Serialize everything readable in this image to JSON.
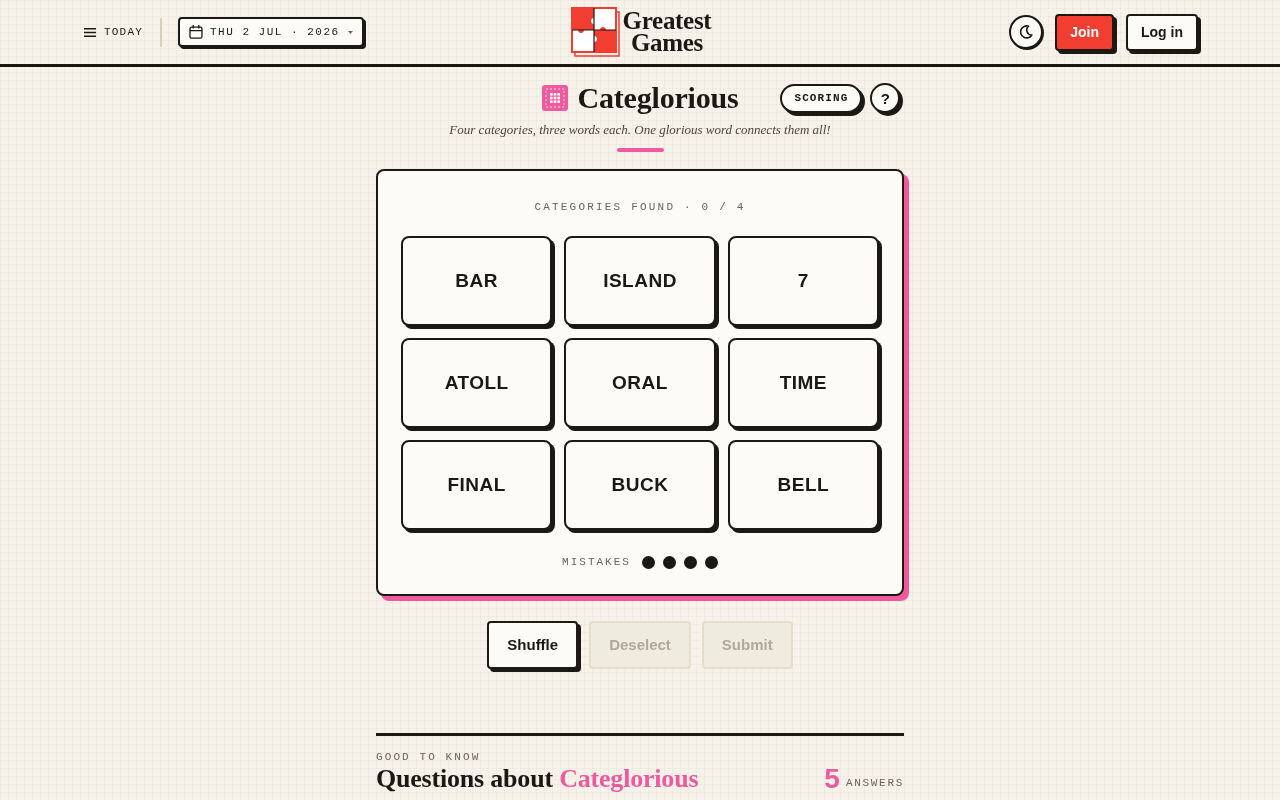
{
  "header": {
    "menu_label": "TODAY",
    "date": "THU 2 JUL · 2026",
    "logo_lines": [
      "Greatest",
      "Games"
    ],
    "join": "Join",
    "login": "Log in"
  },
  "game": {
    "title": "Categlorious",
    "scoring": "SCORING",
    "help": "?",
    "subtitle": "Four categories, three words each. One glorious word connects them all!",
    "progress": "CATEGORIES FOUND · 0 / 4",
    "tiles": [
      {
        "word": "BAR",
        "selected": false
      },
      {
        "word": "ISLAND",
        "selected": false
      },
      {
        "word": "7",
        "selected": false
      },
      {
        "word": "ATOLL",
        "selected": false
      },
      {
        "word": "ORAL",
        "selected": false
      },
      {
        "word": "TIME",
        "selected": false
      },
      {
        "word": "FINAL",
        "selected": false
      },
      {
        "word": "BUCK",
        "selected": false
      },
      {
        "word": "BELL",
        "selected": false
      }
    ],
    "mistakes_label": "MISTAKES",
    "mistakes": [
      {
        "used": false
      },
      {
        "used": false
      },
      {
        "used": false
      },
      {
        "used": false
      }
    ]
  },
  "actions": [
    {
      "label": "Shuffle",
      "disabled": false
    },
    {
      "label": "Deselect",
      "disabled": true
    },
    {
      "label": "Submit",
      "disabled": true
    }
  ],
  "faq": {
    "eyebrow": "GOOD TO KNOW",
    "title": "Questions about",
    "title_highlight": "Categlorious",
    "count": "5",
    "count_label": "ANSWERS"
  }
}
